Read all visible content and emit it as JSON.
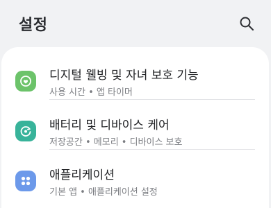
{
  "header": {
    "title": "설정",
    "search_icon": "search-icon"
  },
  "items": [
    {
      "title": "디지털 웰빙 및 자녀 보호 기능",
      "subtitle": "사용 시간 • 앱 타이머",
      "icon": "digital-wellbeing-icon",
      "icon_color": "#6cc36a"
    },
    {
      "title": "배터리 및 디바이스 케어",
      "subtitle": "저장공간 • 메모리 • 디바이스 보호",
      "icon": "device-care-icon",
      "icon_color": "#38b39a"
    },
    {
      "title": "애플리케이션",
      "subtitle": "기본 앱 • 애플리케이션 설정",
      "icon": "apps-grid-icon",
      "icon_color": "#6c99ea"
    }
  ]
}
